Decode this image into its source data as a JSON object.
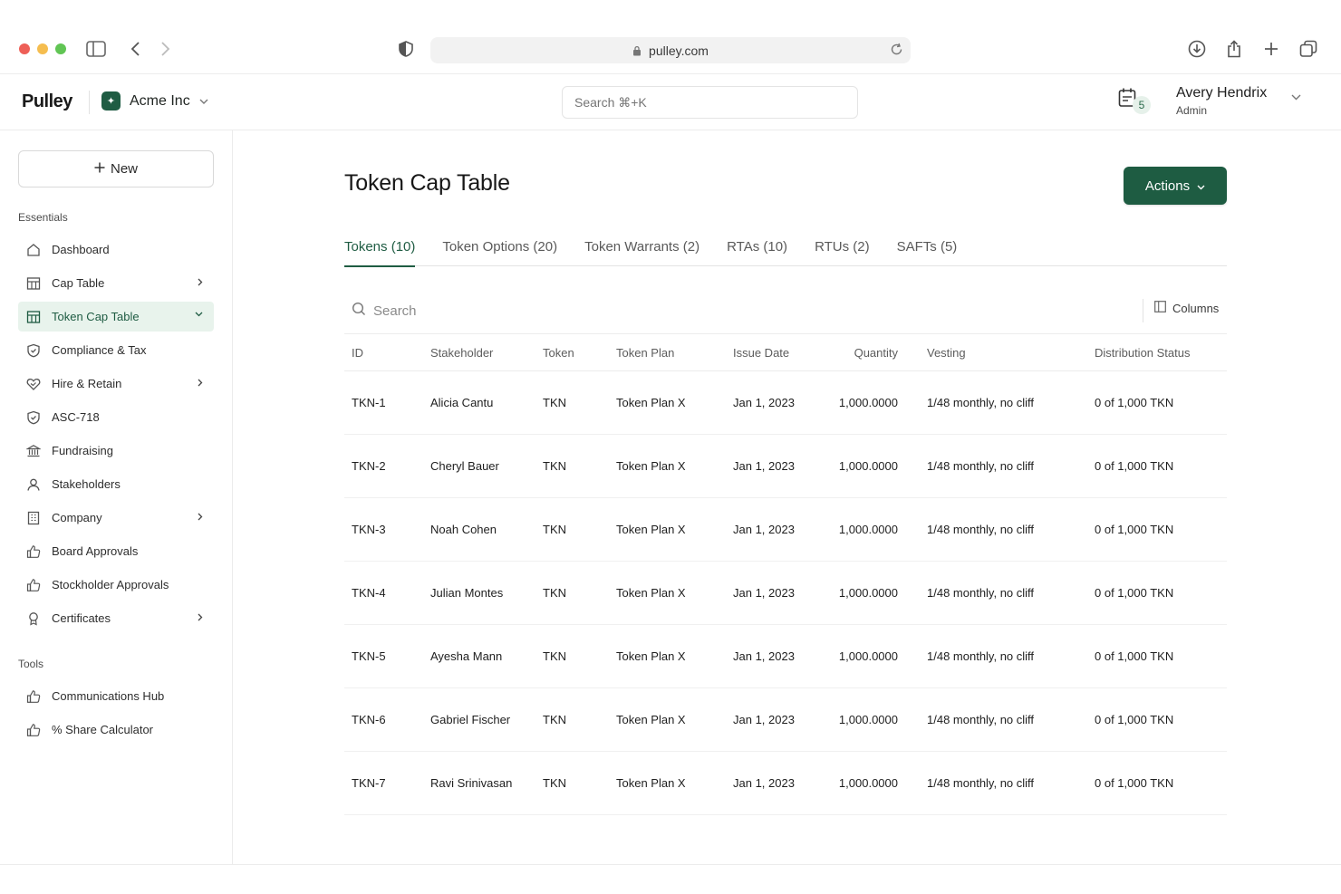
{
  "browser": {
    "url": "pulley.com"
  },
  "header": {
    "logo": "Pulley",
    "org_name": "Acme Inc",
    "search_placeholder": "Search ⌘+K",
    "notification_count": "5",
    "user_name": "Avery Hendrix",
    "user_role": "Admin"
  },
  "sidebar": {
    "new_label": "New",
    "essentials_label": "Essentials",
    "tools_label": "Tools",
    "essentials": [
      {
        "label": "Dashboard",
        "icon": "home-icon",
        "chevron": ""
      },
      {
        "label": "Cap Table",
        "icon": "table-icon",
        "chevron": "right"
      },
      {
        "label": "Token Cap Table",
        "icon": "table-icon",
        "chevron": "down",
        "active": true
      },
      {
        "label": "Compliance & Tax",
        "icon": "shield-check-icon",
        "chevron": ""
      },
      {
        "label": "Hire & Retain",
        "icon": "heart-handshake-icon",
        "chevron": "right"
      },
      {
        "label": "ASC-718",
        "icon": "shield-check-icon",
        "chevron": ""
      },
      {
        "label": "Fundraising",
        "icon": "bank-icon",
        "chevron": ""
      },
      {
        "label": "Stakeholders",
        "icon": "user-icon",
        "chevron": ""
      },
      {
        "label": "Company",
        "icon": "building-icon",
        "chevron": "right"
      },
      {
        "label": "Board Approvals",
        "icon": "thumbs-up-icon",
        "chevron": ""
      },
      {
        "label": "Stockholder Approvals",
        "icon": "thumbs-up-icon",
        "chevron": ""
      },
      {
        "label": "Certificates",
        "icon": "award-icon",
        "chevron": "right"
      }
    ],
    "tools": [
      {
        "label": "Communications Hub",
        "icon": "thumbs-up-icon"
      },
      {
        "label": "% Share Calculator",
        "icon": "thumbs-up-icon"
      }
    ]
  },
  "main": {
    "title": "Token Cap Table",
    "actions_label": "Actions",
    "tabs": [
      {
        "label": "Tokens (10)",
        "active": true
      },
      {
        "label": "Token Options (20)"
      },
      {
        "label": "Token Warrants (2)"
      },
      {
        "label": "RTAs (10)"
      },
      {
        "label": "RTUs (2)"
      },
      {
        "label": "SAFTs (5)"
      }
    ],
    "search_placeholder": "Search",
    "columns_label": "Columns",
    "table": {
      "headers": [
        "ID",
        "Stakeholder",
        "Token",
        "Token Plan",
        "Issue Date",
        "Quantity",
        "Vesting",
        "Distribution Status"
      ],
      "rows": [
        [
          "TKN-1",
          "Alicia Cantu",
          "TKN",
          "Token Plan X",
          "Jan 1, 2023",
          "1,000.0000",
          "1/48 monthly, no cliff",
          "0 of 1,000 TKN"
        ],
        [
          "TKN-2",
          "Cheryl Bauer",
          "TKN",
          "Token Plan X",
          "Jan 1, 2023",
          "1,000.0000",
          "1/48 monthly, no cliff",
          "0 of 1,000 TKN"
        ],
        [
          "TKN-3",
          "Noah Cohen",
          "TKN",
          "Token Plan X",
          "Jan 1, 2023",
          "1,000.0000",
          "1/48 monthly, no cliff",
          "0 of 1,000 TKN"
        ],
        [
          "TKN-4",
          "Julian Montes",
          "TKN",
          "Token Plan X",
          "Jan 1, 2023",
          "1,000.0000",
          "1/48 monthly, no cliff",
          "0 of 1,000 TKN"
        ],
        [
          "TKN-5",
          "Ayesha Mann",
          "TKN",
          "Token Plan X",
          "Jan 1, 2023",
          "1,000.0000",
          "1/48 monthly, no cliff",
          "0 of 1,000 TKN"
        ],
        [
          "TKN-6",
          "Gabriel Fischer",
          "TKN",
          "Token Plan X",
          "Jan 1, 2023",
          "1,000.0000",
          "1/48 monthly, no cliff",
          "0 of 1,000 TKN"
        ],
        [
          "TKN-7",
          "Ravi Srinivasan",
          "TKN",
          "Token Plan X",
          "Jan 1, 2023",
          "1,000.0000",
          "1/48 monthly, no cliff",
          "0 of 1,000 TKN"
        ]
      ]
    }
  },
  "colors": {
    "brand_green": "#1e5c42",
    "active_bg": "#e8f3ec"
  }
}
